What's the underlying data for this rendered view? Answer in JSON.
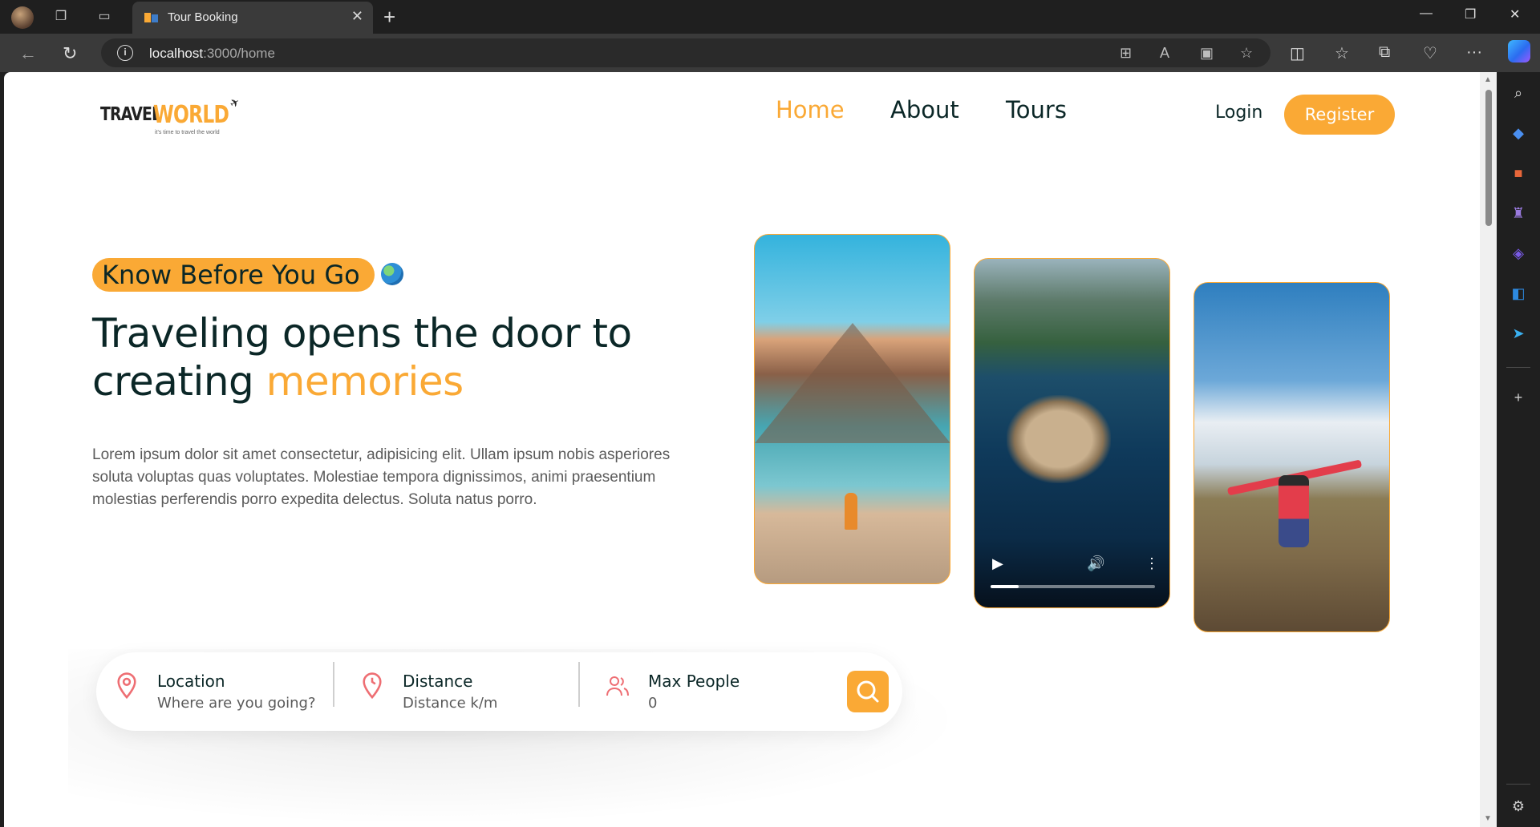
{
  "browser": {
    "tab_title": "Tour Booking",
    "url_host": "localhost",
    "url_path": ":3000/home"
  },
  "site": {
    "logo": {
      "word1": "TRAVEL",
      "word2": "WORLD",
      "tag": "it's time to travel the world"
    },
    "nav": [
      {
        "label": "Home",
        "active": true
      },
      {
        "label": "About",
        "active": false
      },
      {
        "label": "Tours",
        "active": false
      }
    ],
    "login_label": "Login",
    "register_label": "Register",
    "accent_color": "#faa935"
  },
  "hero": {
    "subtitle": "Know Before You Go",
    "title_part1": "Traveling opens the door to creating ",
    "title_highlight": "memories",
    "description": "Lorem ipsum dolor sit amet consectetur, adipisicing elit. Ullam ipsum nobis asperiores soluta voluptas quas voluptates. Molestiae tempora dignissimos, animi praesentium molestias perferendis porro expedita delectus. Soluta natus porro."
  },
  "search": {
    "fields": [
      {
        "label": "Location",
        "placeholder": "Where are you going?",
        "icon": "map-pin-icon"
      },
      {
        "label": "Distance",
        "placeholder": "Distance k/m",
        "icon": "map-pin-time-icon"
      },
      {
        "label": "Max People",
        "placeholder": "0",
        "icon": "group-icon"
      }
    ],
    "button_icon": "search-icon"
  }
}
